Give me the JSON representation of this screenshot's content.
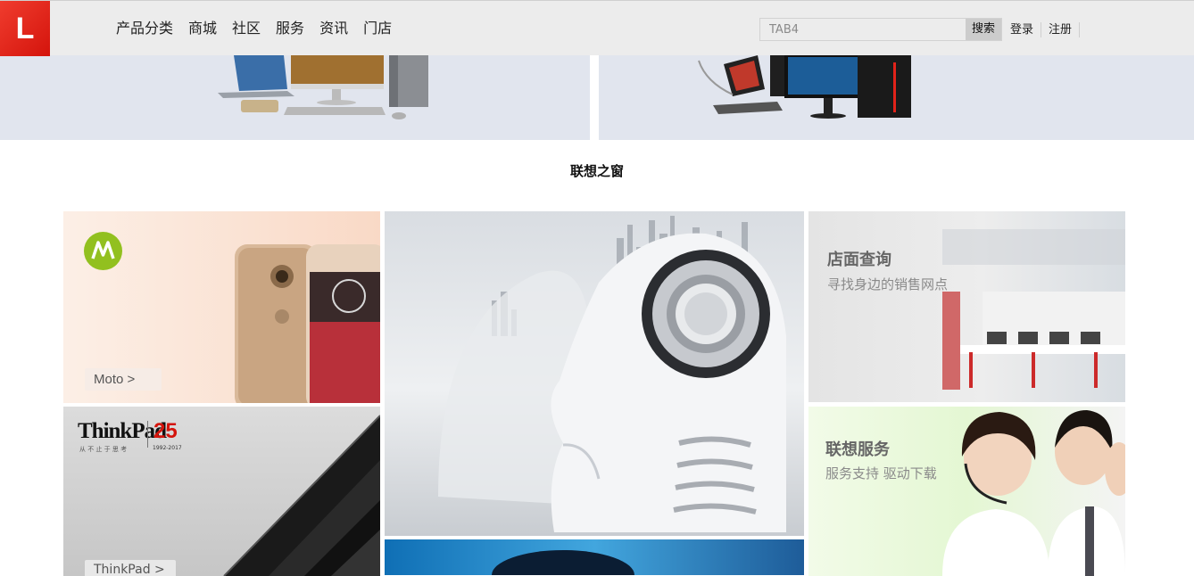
{
  "header": {
    "logo_text": "L",
    "nav_items": [
      "产品分类",
      "商城",
      "社区",
      "服务",
      "资讯",
      "门店"
    ],
    "search": {
      "placeholder": "TAB4",
      "button_label": "搜索"
    },
    "login_label": "登录",
    "register_label": "注册"
  },
  "section": {
    "title": "联想之窗"
  },
  "tiles": {
    "moto": {
      "button_label": "Moto >"
    },
    "thinkpad": {
      "brand": "ThinkPad",
      "anniversary": "25",
      "tagline": "从 不 止 于 思 考",
      "years": "1992-2017",
      "button_label": "ThinkPad >"
    },
    "store": {
      "title": "店面查询",
      "subtitle": "寻找身边的销售网点"
    },
    "service": {
      "title": "联想服务",
      "subtitle": "服务支持 驱动下载"
    }
  },
  "colors": {
    "brand_red": "#e2231a",
    "header_bg": "#ececec"
  }
}
